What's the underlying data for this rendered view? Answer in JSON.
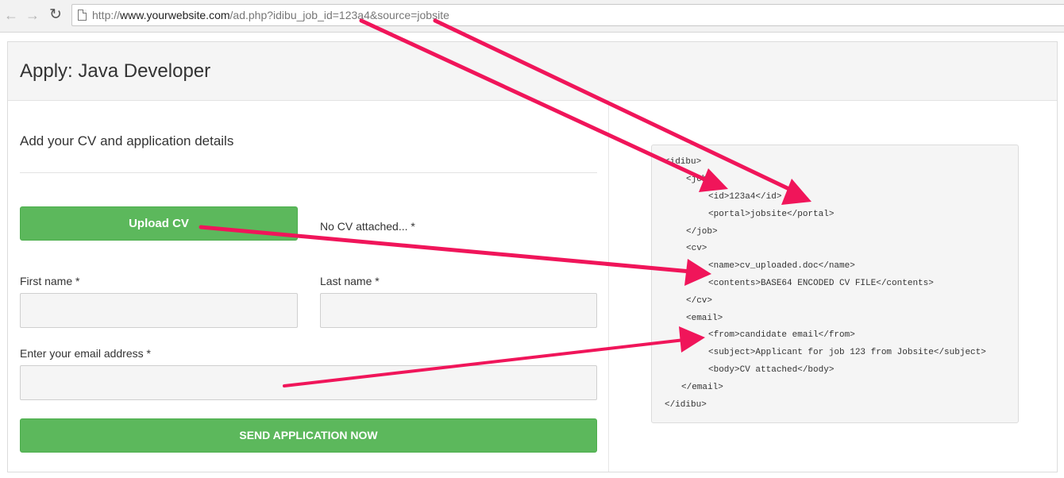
{
  "browser": {
    "url_scheme": "http://",
    "url_host": "www.yourwebsite.com",
    "url_path": "/ad.php?idibu_job_id=123a4&source=jobsite"
  },
  "page": {
    "title": "Apply: Java Developer",
    "section_title": "Add your CV and application details",
    "upload_label": "Upload CV",
    "cv_status": "No CV attached... *",
    "first_name_label": "First name *",
    "last_name_label": "Last name *",
    "email_label": "Enter your email address *",
    "send_label": "SEND APPLICATION NOW"
  },
  "xml": {
    "lines": [
      "<idibu>",
      "<job>",
      "<id>123a4</id>",
      "<portal>jobsite</portal>",
      "</job>",
      "<cv>",
      "<name>cv_uploaded.doc</name>",
      "<contents>BASE64 ENCODED CV FILE</contents>",
      "</cv>",
      "<email>",
      "<from>candidate email</from>",
      "<subject>Applicant for job 123 from Jobsite</subject>",
      "<body>CV attached</body>",
      "</email>",
      "</idibu>"
    ]
  },
  "colors": {
    "accent_green": "#5cb85c",
    "arrow_pink": "#f0155a"
  },
  "icons": [
    "back-arrow-icon",
    "forward-arrow-icon",
    "reload-icon",
    "page-icon"
  ]
}
